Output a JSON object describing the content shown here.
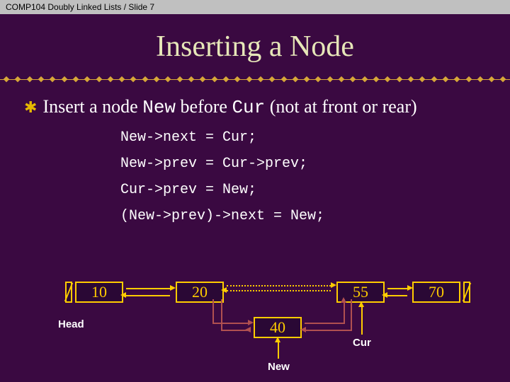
{
  "header": {
    "text": "COMP104 Doubly Linked Lists / Slide 7"
  },
  "title": "Inserting a Node",
  "bullet": {
    "prefix": "Insert a node ",
    "kw1": "New",
    "mid": " before ",
    "kw2": "Cur",
    "suffix": " (not at front or rear)"
  },
  "code": {
    "l1": "New->next = Cur;",
    "l2": "New->prev = Cur->prev;",
    "l3": "Cur->prev = New;",
    "l4": "(New->prev)->next = New;"
  },
  "diagram": {
    "nodes": {
      "n1": "10",
      "n2": "20",
      "n3": "55",
      "n4": "70",
      "newNode": "40"
    },
    "labels": {
      "head": "Head",
      "cur": "Cur",
      "new": "New"
    }
  }
}
